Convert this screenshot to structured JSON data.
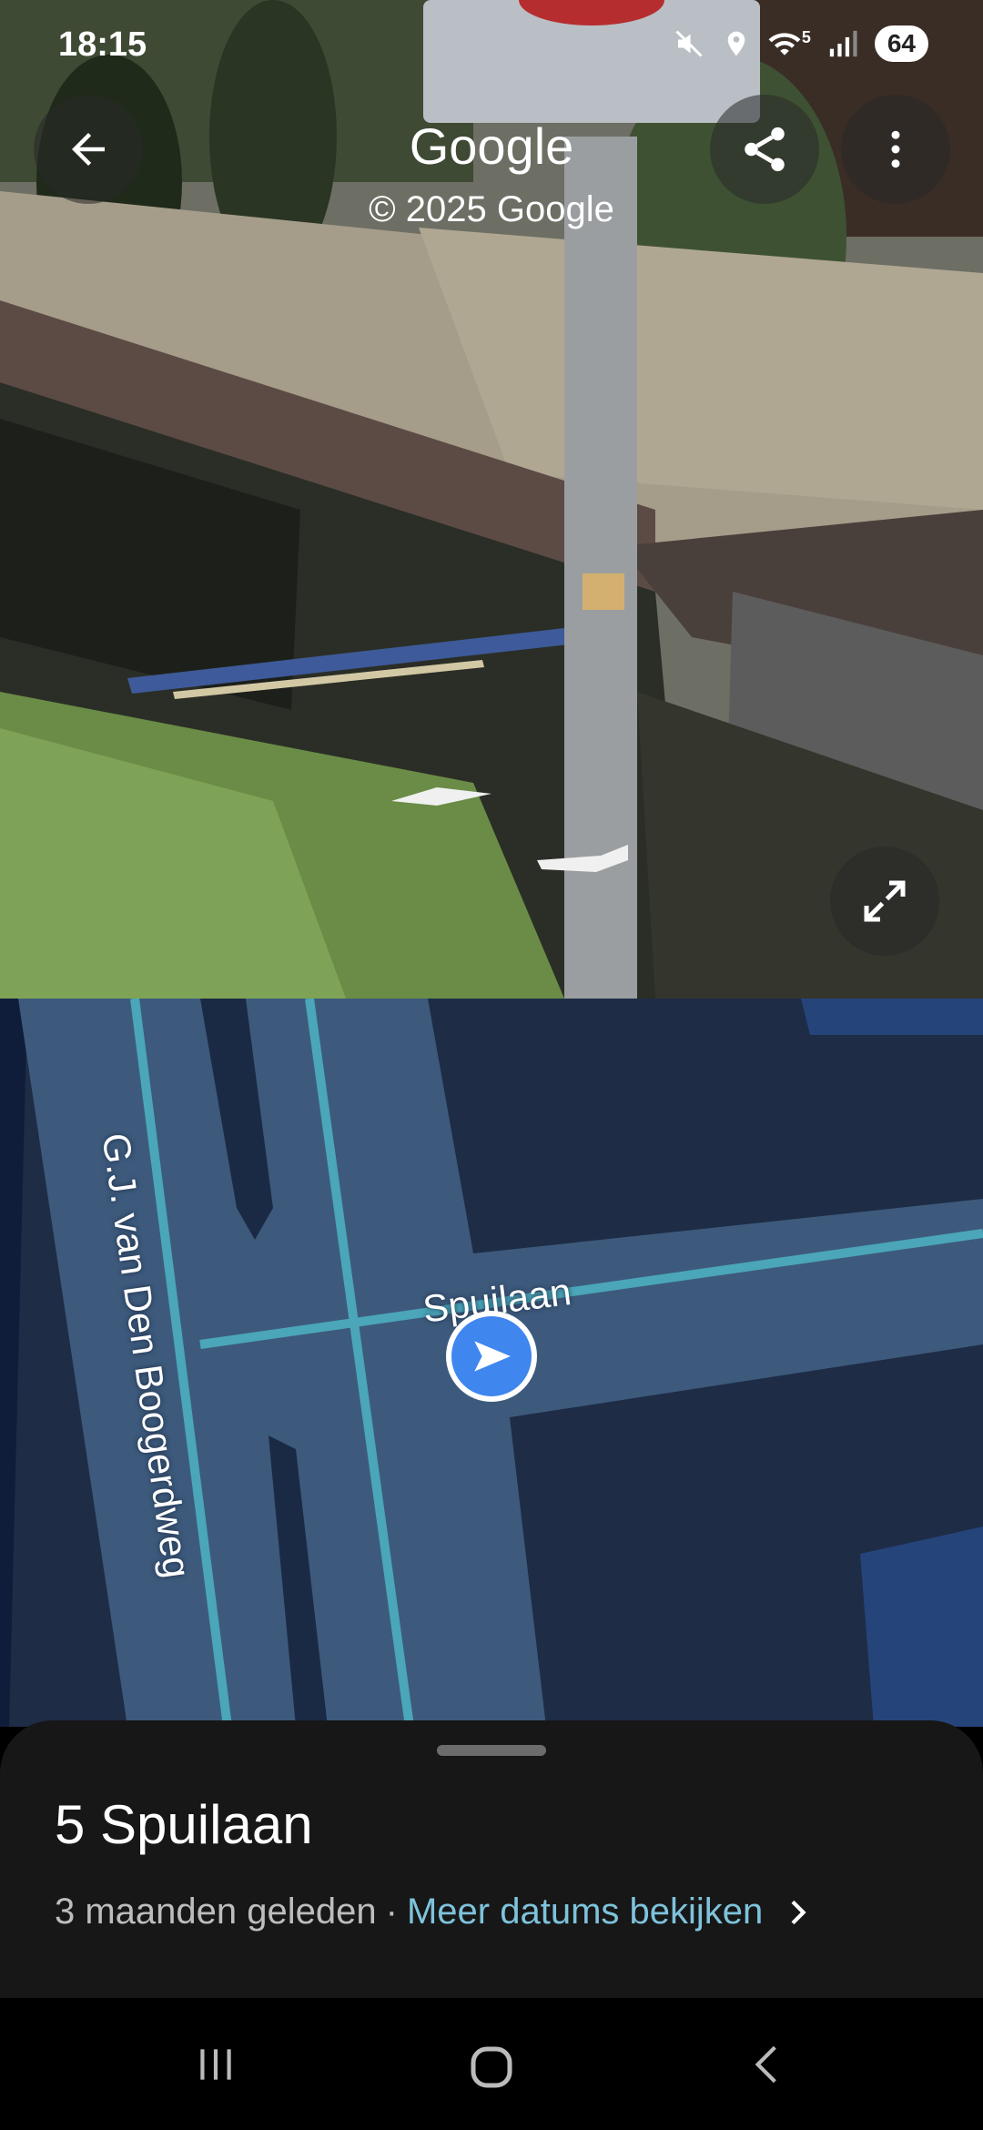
{
  "status_bar": {
    "time": "18:15",
    "battery": "64",
    "network_label": "5"
  },
  "header": {
    "title": "Google",
    "subtitle": "© 2025 Google",
    "back_icon": "arrow-left-icon",
    "share_icon": "share-icon",
    "more_icon": "more-vert-icon"
  },
  "map": {
    "street_vertical": "G.J. van Den Boogerdweg",
    "street_horizontal": "Spuilaan",
    "colors": {
      "base": "#1f2d47",
      "road": "#3d5a7c",
      "road_line": "#4aa6b8"
    }
  },
  "sheet": {
    "address": "5 Spuilaan",
    "age": "3 maanden geleden",
    "separator": "·",
    "link": "Meer datums bekijken"
  },
  "nav": {
    "recent_icon": "recent-apps-icon",
    "home_icon": "home-icon",
    "back_icon": "back-nav-icon"
  }
}
